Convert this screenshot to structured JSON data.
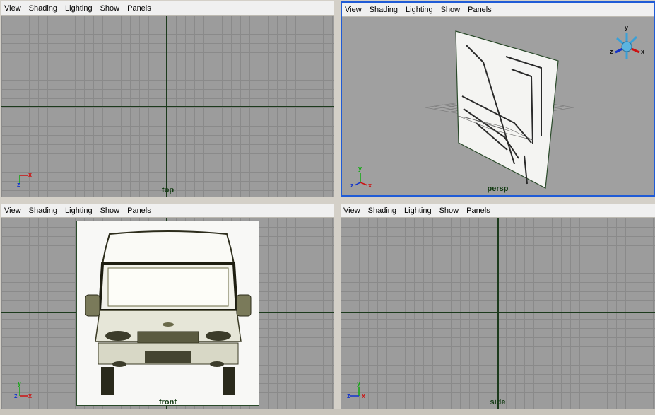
{
  "menu": [
    "View",
    "Shading",
    "Lighting",
    "Show",
    "Panels"
  ],
  "panels": {
    "top": {
      "camera": "top"
    },
    "persp": {
      "camera": "persp"
    },
    "front": {
      "camera": "front"
    },
    "side": {
      "camera": "side"
    }
  },
  "axis_labels": {
    "x": "x",
    "y": "y",
    "z": "z"
  },
  "colors": {
    "active_border": "#1f5bd6",
    "x_axis": "#cc1111",
    "y_axis": "#11aa11",
    "z_axis": "#1133cc",
    "grid_axis": "#1c3a1c"
  },
  "icons": [
    "view-cube-icon",
    "axis-gizmo-icon"
  ]
}
